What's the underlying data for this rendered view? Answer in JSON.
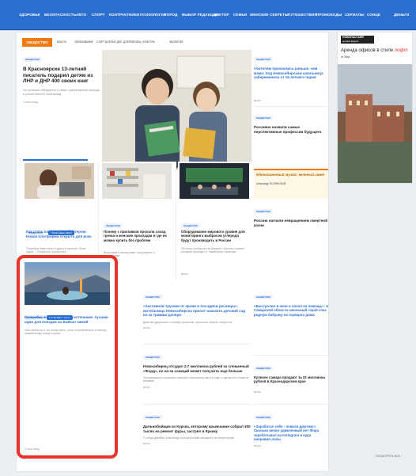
{
  "nav": {
    "items": [
      "ЗДОРОВЬЕ",
      "БЕЗОПАСНОСТЬ",
      "АВТО",
      "СПОРТ",
      "КОНТРАКТНИКИ",
      "ПСИХОЛОГИЯ",
      "ГОРОД",
      "ВЫБОР РЕДАКЦИИ",
      "ДОКТОР",
      "СЕМЬЯ",
      "ЖЕНСКИЕ СЕКРЕТЫ",
      "ПУТЕШЕСТВИЯ",
      "ПРОМОКОДЫ",
      "СЕРИАЛЫ",
      "СОНЦЕ",
      "ДЕНЬГИ"
    ]
  },
  "section": {
    "badge": "ОБЩЕСТВО",
    "subs": [
      "ВЛАСТЬ",
      "ОБРАЗОВАНИЕ",
      "СТАРТ ДОБРЫХ ДЕЛ",
      "ДОБРОВОЛЕЦ",
      "КУЛЬТУРА",
      "ЭКОЛОГИЯ"
    ]
  },
  "lead_story": {
    "tag": "ОБЩЕСТВО",
    "title": "В Красноярске 13-летний писатель подарил детям из ЛНР и ДНР 400 своих книг",
    "lead": "Он успешно объединил о сборе гуманитарной помощи и решил внести свой вклад",
    "time": "3 часа назад",
    "photo_caption": "Егор и Мария"
  },
  "right_col": [
    {
      "tag": "ОБЩЕСТВО",
      "title": "Учителям признались раньше, чем мама: под Новосибирском школьница забеременела от 16-летнего парня",
      "time": "вчера"
    },
    {
      "tag": "ОБЩЕСТВО",
      "title": "Россияне назвали самые перспективные профессии будущего",
      "time": ""
    },
    {
      "tag": "",
      "title": "Единственный музей: зеленый свет",
      "author": "Александр ПОЛЯНСКИЙ",
      "time": ""
    },
    {
      "tag": "ОБЩЕСТВО",
      "title": "Россию нагнали невращением смертной казни",
      "time": ""
    }
  ],
  "row2": [
    {
      "tags": [
        "ОБЩЕСТВО",
        "ПРОИСШЕСТВИЯ"
      ],
      "title": "Как стать популярным блогером: Новая платформа открыта для всех",
      "lead": "Потребуя свою силы и удачу в проекте «Блог нарис – Открытые горизонты»",
      "time": "3 часа назад"
    },
    {
      "tag": "ОБЩЕСТВО",
      "title": "Почему с прилавков пропали сахар, гречка и женские прокладки и где их можно купить без проблем",
      "lead": "Выясняем с экспертами, популярнее и продавцами",
      "time": ""
    },
    {
      "tag": "ОБЩЕСТВО",
      "title": "Оборудование мирового уровня для мониторинга выбросов углерода будут производить в России",
      "lead": "Об этом сообщили на форуме «Чистая страна», который проходит в Тюменском Сколково",
      "time": "вчера"
    }
  ],
  "highlight": {
    "tags": [
      "ОБЩЕСТВО",
      "ПРОИСШЕСТВИЯ"
    ],
    "title": "Волшебный лед и горячие источники: лучшие идеи для поездки на Байкал зимой",
    "lead": "Чем заняться и что посмотреть, если отправляетесь к самому знаменитому озеру страны",
    "time": "3 часа назад"
  },
  "center_list": [
    {
      "tag": "ОБЩЕСТВО",
      "title": "«Заставили трусики от крови и посадили ресницы»: жительница Новосибирска просит наказать детский сад из-за травмы дочери",
      "lead": "Девочка ударилась о клюмку прицепом, пришлось зашить отверстие",
      "time": "вчера"
    },
    {
      "tag": "ОБЩЕСТВО",
      "title": "Новосибирец отсудил 2,7 миллиона рублей за сломанный «Форд», но из-за санкций может получить еще больше",
      "lead": "Производитель иномарки повторно перечислил авто в суде и сделал это снова не впервые",
      "time": "вчера"
    },
    {
      "tag": "ОБЩЕСТВО",
      "title": "Дальнобойщик из Курска, которому крымчанин собрал 300 тысяч на ремонт фуры, застрял в Крыму",
      "lead": "С конца декабря Александр Колонитонский находится на полуострове",
      "time": "вчера"
    }
  ],
  "right_list": [
    {
      "tag": "ОБЩЕСТВО",
      "title": "«Выстрелил в окно и попал на помощь»: в Самарской области школьный герой спас родную бабушку из горящего дома",
      "time": ""
    },
    {
      "tag": "ОБЩЕСТВО",
      "title": "Куличек самара продают за 22 миллиона рублей в Краснодарском крае",
      "time": "вчера"
    },
    {
      "tag": "ОБЩЕСТВО",
      "title": "«Заработал себе - помоги другому»: Сколько вечно удивленный нет Фора зарабатывал на Instagram и куда направил лалы",
      "time": "вчера"
    }
  ],
  "ad": {
    "logo": "НОВОПАССКИЙ",
    "logo_sub": "деловой квартал",
    "title": "Аренда офисов в стиле",
    "accent": "лофт",
    "area": "от 30м²"
  },
  "more_label": "ПОСМОТРЕТЬ ВСЕ",
  "colors": {
    "brand": "#2b6fd1",
    "accent": "#f07a12",
    "highlight": "#e8342b"
  }
}
